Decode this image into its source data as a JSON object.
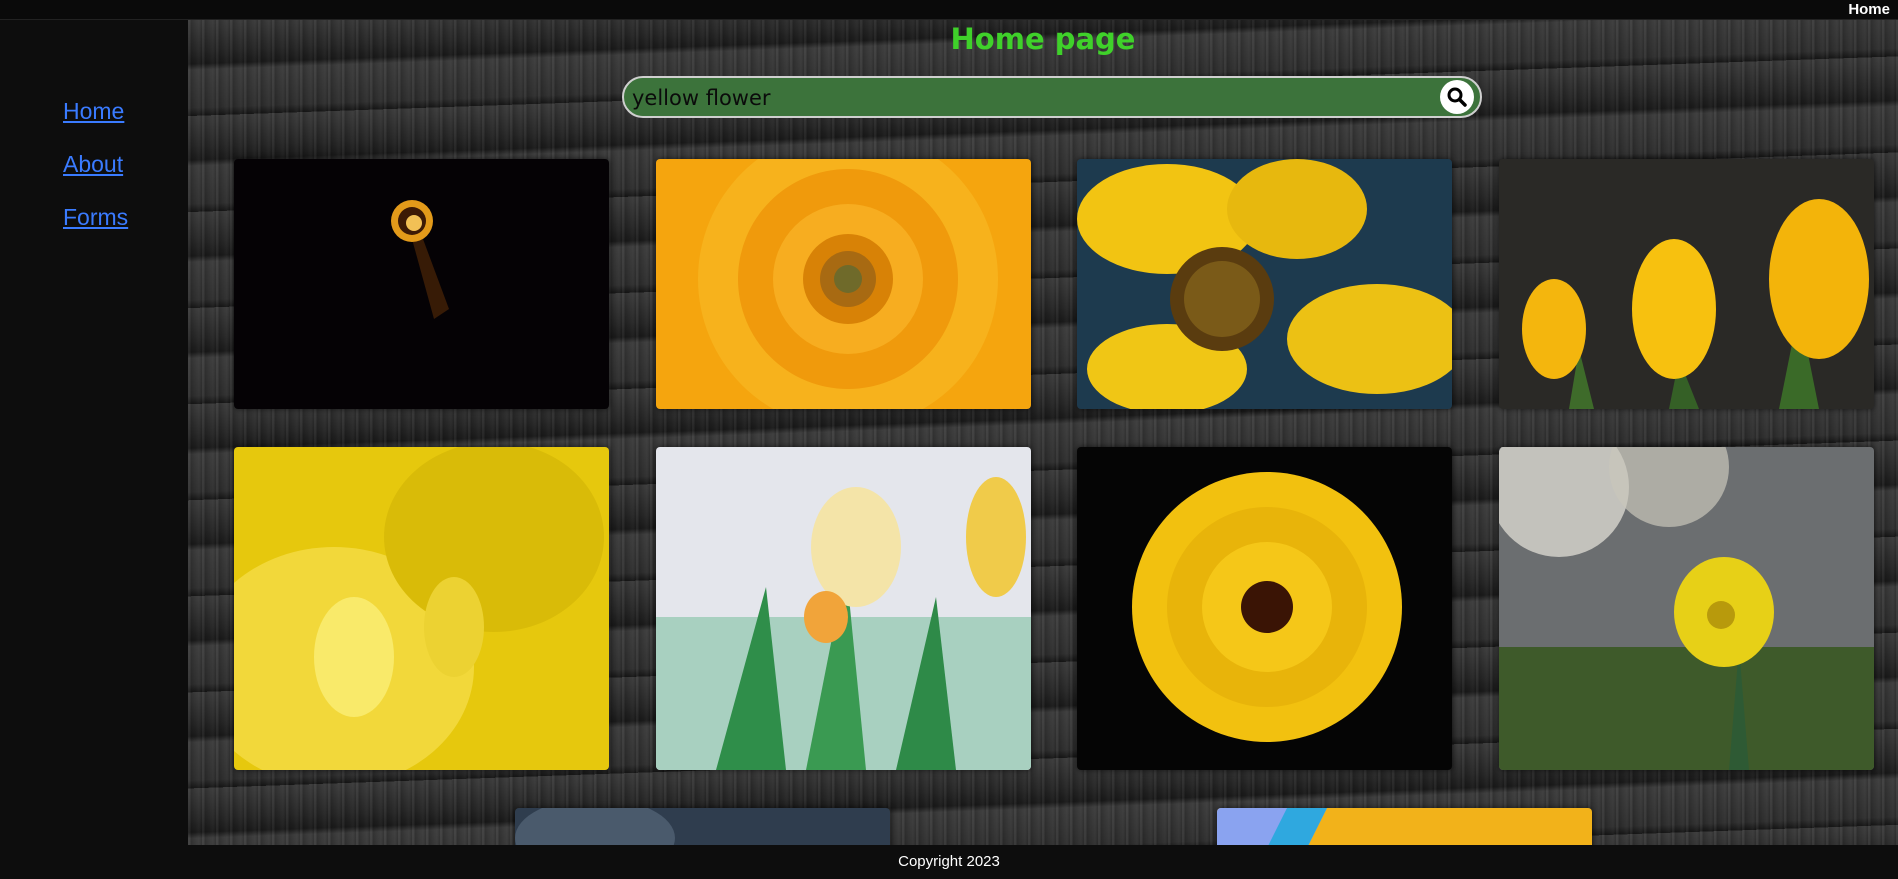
{
  "topbar": {
    "home_label": "Home"
  },
  "sidebar": {
    "items": [
      {
        "label": "Home"
      },
      {
        "label": "About"
      },
      {
        "label": "Forms"
      }
    ]
  },
  "main": {
    "title": "Home page",
    "search": {
      "value": "yellow flower"
    }
  },
  "footer": {
    "text": "Copyright 2023"
  },
  "colors": {
    "title": "#3fd12a",
    "search_bg": "#3c733b",
    "link": "#3a7bff"
  },
  "icons": {
    "search": "magnifier-icon"
  }
}
